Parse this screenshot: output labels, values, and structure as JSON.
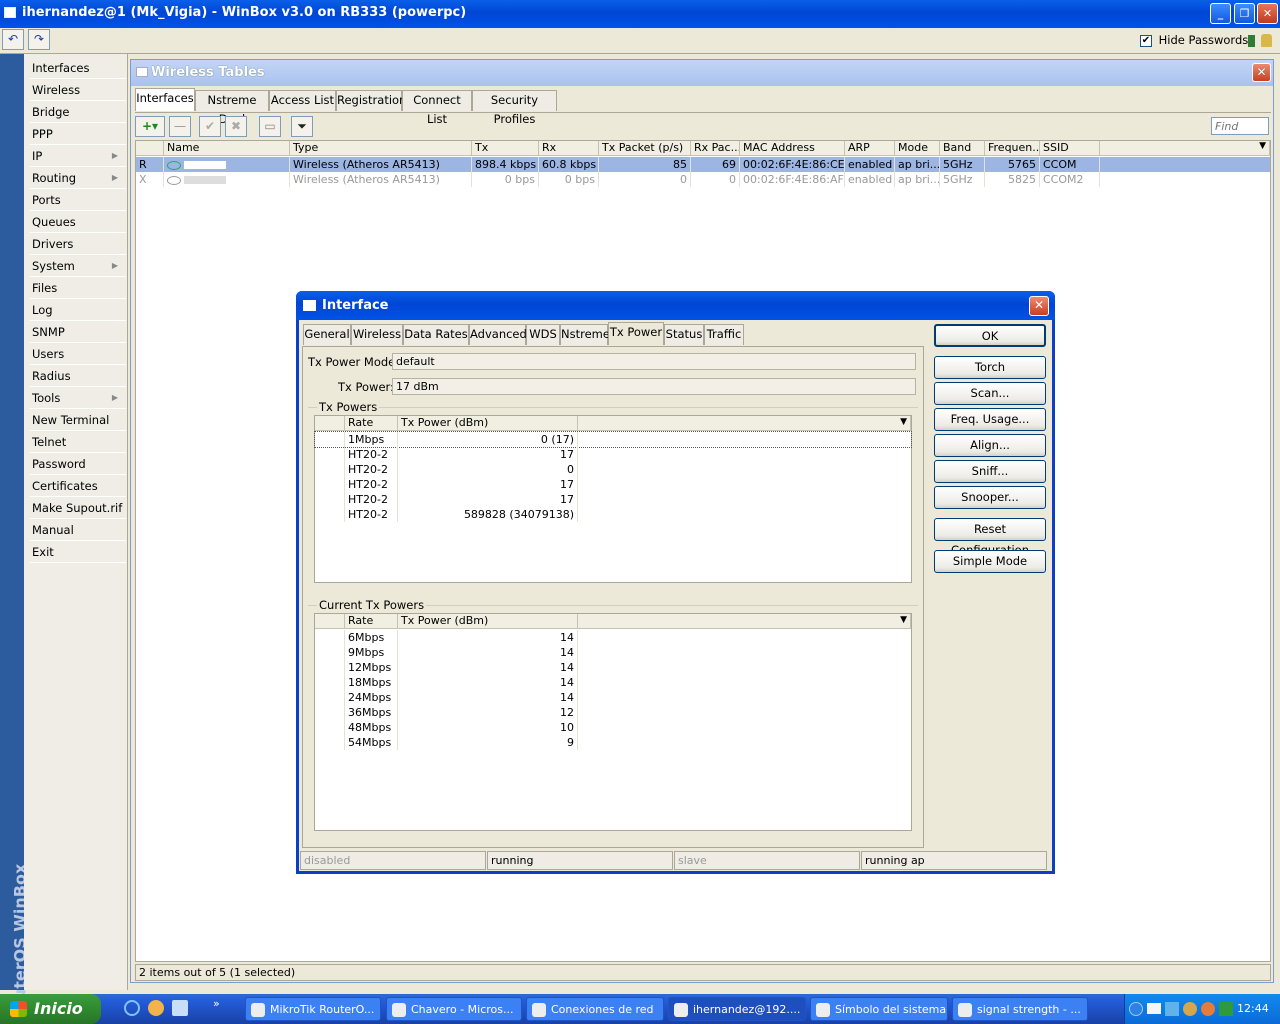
{
  "window": {
    "title": "ihernandez@1            (Mk_Vigia) - WinBox v3.0 on RB333 (powerpc)",
    "hide_passwords_label": "Hide Passwords",
    "hide_passwords_checked": true
  },
  "vertical_brand": "RouterOS WinBox",
  "sidebar": {
    "items": [
      {
        "label": "Interfaces",
        "submenu": false
      },
      {
        "label": "Wireless",
        "submenu": false
      },
      {
        "label": "Bridge",
        "submenu": false
      },
      {
        "label": "PPP",
        "submenu": false
      },
      {
        "label": "IP",
        "submenu": true
      },
      {
        "label": "Routing",
        "submenu": true
      },
      {
        "label": "Ports",
        "submenu": false
      },
      {
        "label": "Queues",
        "submenu": false
      },
      {
        "label": "Drivers",
        "submenu": false
      },
      {
        "label": "System",
        "submenu": true
      },
      {
        "label": "Files",
        "submenu": false
      },
      {
        "label": "Log",
        "submenu": false
      },
      {
        "label": "SNMP",
        "submenu": false
      },
      {
        "label": "Users",
        "submenu": false
      },
      {
        "label": "Radius",
        "submenu": false
      },
      {
        "label": "Tools",
        "submenu": true
      },
      {
        "label": "New Terminal",
        "submenu": false
      },
      {
        "label": "Telnet",
        "submenu": false
      },
      {
        "label": "Password",
        "submenu": false
      },
      {
        "label": "Certificates",
        "submenu": false
      },
      {
        "label": "Make Supout.rif",
        "submenu": false
      },
      {
        "label": "Manual",
        "submenu": false
      },
      {
        "label": "Exit",
        "submenu": false
      }
    ]
  },
  "wireless_tables": {
    "title": "Wireless Tables",
    "tabs": [
      "Interfaces",
      "Nstreme Dual",
      "Access List",
      "Registration",
      "Connect List",
      "Security Profiles"
    ],
    "find_placeholder": "Find",
    "columns": [
      "Name",
      "Type",
      "Tx",
      "Rx",
      "Tx Packet (p/s)",
      "Rx Pac...",
      "MAC Address",
      "ARP",
      "Mode",
      "Band",
      "Frequen...",
      "SSID"
    ],
    "rows": [
      {
        "flag": "R",
        "name": "",
        "type": "Wireless (Atheros AR5413)",
        "tx": "898.4 kbps",
        "rx": "60.8 kbps",
        "tx_packet": "85",
        "rx_packet": "69",
        "mac": "00:02:6F:4E:86:CE",
        "arp": "enabled",
        "mode": "ap bri...",
        "band": "5GHz",
        "freq": "5765",
        "ssid": "CCOM",
        "selected": true
      },
      {
        "flag": "X",
        "name": "",
        "type": "Wireless (Atheros AR5413)",
        "tx": "0 bps",
        "rx": "0 bps",
        "tx_packet": "0",
        "rx_packet": "0",
        "mac": "00:02:6F:4E:86:AF",
        "arp": "enabled",
        "mode": "ap bri...",
        "band": "5GHz",
        "freq": "5825",
        "ssid": "CCOM2",
        "selected": false
      }
    ],
    "status": "2 items out of 5 (1 selected)"
  },
  "interface_dialog": {
    "title": "Interface",
    "tabs": [
      "General",
      "Wireless",
      "Data Rates",
      "Advanced",
      "WDS",
      "Nstreme",
      "Tx Power",
      "Status",
      "Traffic"
    ],
    "active_tab": "Tx Power",
    "tx_power_mode_label": "Tx Power Mode:",
    "tx_power_mode_value": "default",
    "tx_power_label": "Tx Power:",
    "tx_power_value": "17 dBm",
    "tx_powers_group": "Tx Powers",
    "current_tx_powers_group": "Current Tx Powers",
    "col_rate": "Rate",
    "col_tx_power": "Tx Power (dBm)",
    "tx_powers": [
      {
        "rate": "1Mbps",
        "power": "0 (17)"
      },
      {
        "rate": "HT20-2",
        "power": "17"
      },
      {
        "rate": "HT20-2",
        "power": "0"
      },
      {
        "rate": "HT20-2",
        "power": "17"
      },
      {
        "rate": "HT20-2",
        "power": "17"
      },
      {
        "rate": "HT20-2",
        "power": "589828 (34079138)"
      }
    ],
    "current_tx_powers": [
      {
        "rate": "6Mbps",
        "power": "14"
      },
      {
        "rate": "9Mbps",
        "power": "14"
      },
      {
        "rate": "12Mbps",
        "power": "14"
      },
      {
        "rate": "18Mbps",
        "power": "14"
      },
      {
        "rate": "24Mbps",
        "power": "14"
      },
      {
        "rate": "36Mbps",
        "power": "12"
      },
      {
        "rate": "48Mbps",
        "power": "10"
      },
      {
        "rate": "54Mbps",
        "power": "9"
      }
    ],
    "buttons": [
      "OK",
      "Torch",
      "Scan...",
      "Freq. Usage...",
      "Align...",
      "Sniff...",
      "Snooper...",
      "Reset Configuration",
      "Simple Mode"
    ],
    "status": [
      "disabled",
      "running",
      "slave",
      "running ap"
    ]
  },
  "taskbar": {
    "start_label": "Inicio",
    "tasks": [
      "MikroTik RouterO...",
      "Chavero - Micros...",
      "Conexiones de red",
      "ihernandez@192....",
      "Símbolo del sistema",
      "signal strength - ..."
    ],
    "active_task_index": 3,
    "clock": "12:44"
  }
}
